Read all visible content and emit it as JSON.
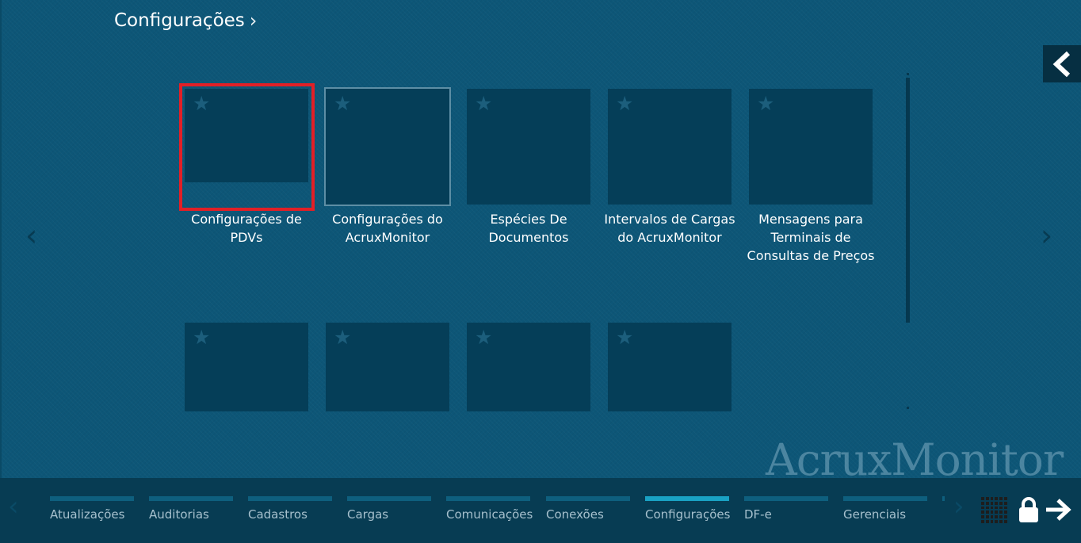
{
  "header": {
    "title": "Configurações",
    "chevron": "›"
  },
  "nav": {
    "back_icon": "chevron-left-icon",
    "prev_page": "‹",
    "next_page": "›"
  },
  "tiles": [
    {
      "label": "Configurações de PDVs",
      "state": "selected"
    },
    {
      "label": "Configurações do AcruxMonitor",
      "state": "hover"
    },
    {
      "label": "Espécies De Documentos",
      "state": "normal"
    },
    {
      "label": "Intervalos de Cargas do AcruxMonitor",
      "state": "normal"
    },
    {
      "label": "Mensagens para Terminais de Consultas de Preços",
      "state": "normal"
    },
    {
      "label": "",
      "state": "normal"
    },
    {
      "label": "",
      "state": "normal"
    },
    {
      "label": "",
      "state": "normal"
    },
    {
      "label": "",
      "state": "normal"
    }
  ],
  "watermark": "AcruxMonitor",
  "taskbar": {
    "prev": "‹",
    "next": "›",
    "tabs": [
      {
        "label": "Atualizações"
      },
      {
        "label": "Auditorias"
      },
      {
        "label": "Cadastros"
      },
      {
        "label": "Cargas"
      },
      {
        "label": "Comunicações"
      },
      {
        "label": "Conexões"
      },
      {
        "label": "Configurações",
        "active": true
      },
      {
        "label": "DF-e"
      },
      {
        "label": "Gerenciais"
      }
    ],
    "icons": [
      "apps-grid-icon",
      "lock-icon",
      "exit-arrow-icon"
    ]
  },
  "colors": {
    "background": "#0d5677",
    "tile": "#053e58",
    "selection_border": "#e21f26",
    "active_tab": "#19a2c4"
  }
}
